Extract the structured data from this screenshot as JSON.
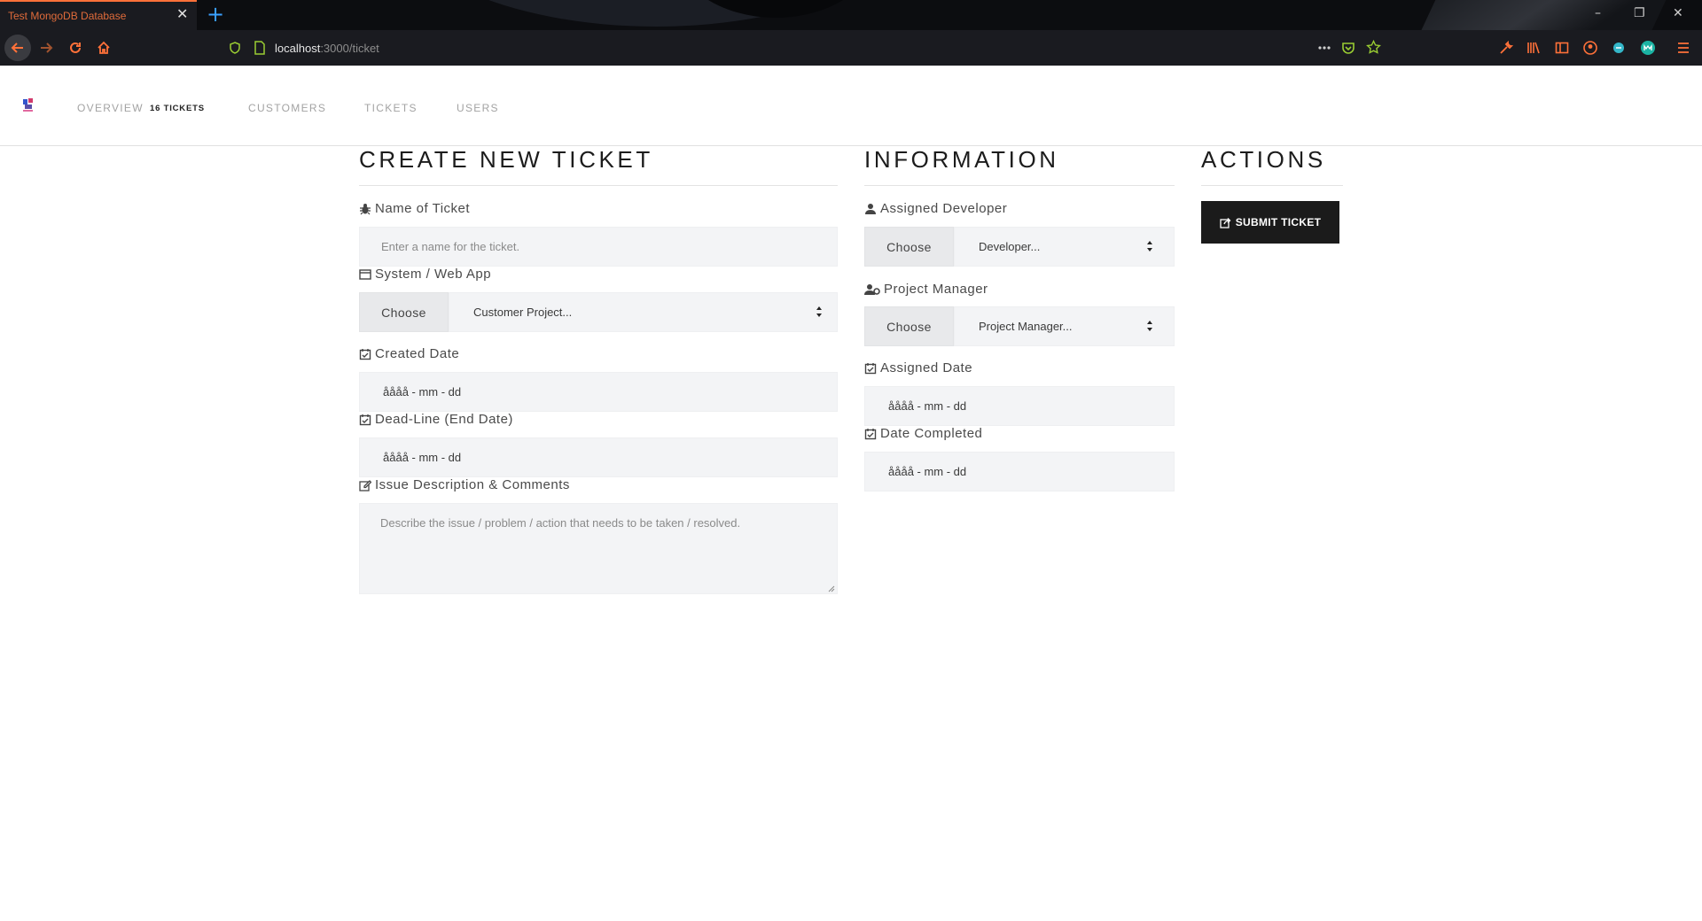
{
  "browser": {
    "tab_title": "Test MongoDB Database",
    "tab_close": "✕",
    "new_tab": "+",
    "url_host": "localhost",
    "url_path": ":3000/ticket",
    "window_controls": {
      "minimize": "–",
      "restore": "❐",
      "close": "✕"
    },
    "accent_color": "#ff7139"
  },
  "header": {
    "menu": {
      "overview": "OVERVIEW",
      "overview_badge": "16 TICKETS",
      "customers": "CUSTOMERS",
      "tickets": "TICKETS",
      "users": "USERS"
    }
  },
  "create": {
    "title": "CREATE NEW TICKET",
    "name_label": "Name of Ticket",
    "name_placeholder": "Enter a name for the ticket.",
    "system_label": "System / Web App",
    "system_choose": "Choose",
    "system_value": "Customer Project...",
    "created_label": "Created Date",
    "created_value": "åååå - mm - dd",
    "deadline_label": "Dead-Line (End Date)",
    "deadline_value": "åååå - mm - dd",
    "issue_label": "Issue Description & Comments",
    "issue_placeholder": "Describe the issue / problem / action that needs to be taken / resolved."
  },
  "information": {
    "title": "INFORMATION",
    "developer_label": "Assigned Developer",
    "developer_choose": "Choose",
    "developer_value": "Developer...",
    "pm_label": "Project Manager",
    "pm_choose": "Choose",
    "pm_value": "Project Manager...",
    "assigned_date_label": "Assigned Date",
    "assigned_date_value": "åååå - mm - dd",
    "completed_label": "Date Completed",
    "completed_value": "åååå - mm - dd"
  },
  "actions": {
    "title": "ACTIONS",
    "submit_label": "SUBMIT TICKET"
  }
}
